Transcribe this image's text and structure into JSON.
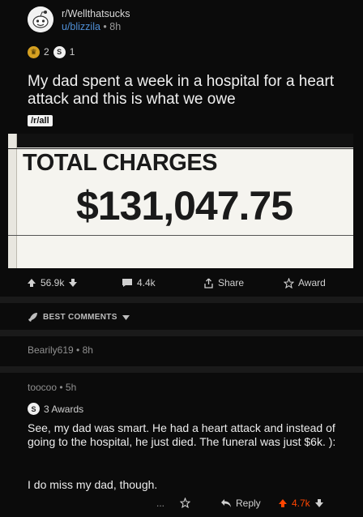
{
  "header": {
    "subreddit": "r/Wellthatsucks",
    "username": "u/blizzila",
    "time_sep": "•",
    "time": "8h"
  },
  "awards": {
    "gold_count": "2",
    "silver_count": "1"
  },
  "post": {
    "title": "My dad spent a week in a hospital for a heart attack and this is what we owe",
    "tag": "/r/all"
  },
  "image": {
    "label": "TOTAL CHARGES",
    "amount": "$131,047.75"
  },
  "actions": {
    "upvotes": "56.9k",
    "comments": "4.4k",
    "share": "Share",
    "award": "Award"
  },
  "sort": {
    "label": "BEST COMMENTS"
  },
  "comments": [
    {
      "author": "Bearily619",
      "sep": "•",
      "time": "8h"
    },
    {
      "author": "toocoo",
      "sep": "•",
      "time": "5h",
      "awards_label": "3 Awards",
      "text1": "See, my dad was smart. He had a heart attack and instead of going to the hospital, he just died. The funeral was just $6k. ):",
      "text2": "I do miss my dad, though.",
      "reply": "Reply",
      "votes": "4.7k",
      "more": "..."
    }
  ],
  "colors": {
    "accent_blue": "#4f8fd6",
    "upvote_red": "#ff4500",
    "gold": "#d5a021"
  }
}
